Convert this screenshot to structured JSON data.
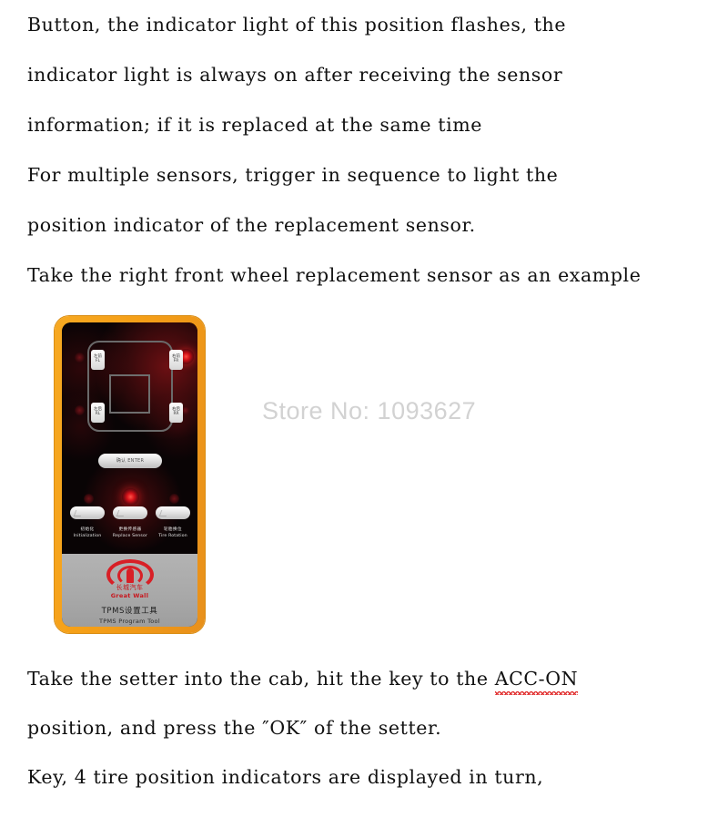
{
  "document": {
    "top_paragraph_lines": [
      "Button, the indicator light of this position flashes, the",
      "indicator light is always on after receiving the sensor",
      "information; if it is replaced at the same time",
      "For multiple sensors, trigger in sequence to light the",
      "position indicator of the replacement sensor.",
      "Take the right front wheel replacement sensor as an example"
    ],
    "bottom_paragraph": {
      "line1_before": "Take the setter into the cab, hit the key to the ",
      "line1_misspelled": "ACC-ON",
      "line2": "position, and press the ″OK″ of the setter.",
      "line3": "Key, 4 tire position indicators are displayed in turn,"
    }
  },
  "watermark": {
    "text": "Store No: 1093627",
    "color": "#d2d2d2"
  },
  "device": {
    "frame_color": "#f5a01a",
    "screen_color": "#090405",
    "panel_color": "#a8a8a8",
    "tire_labels": [
      {
        "position": "front-left",
        "cn": "左前",
        "en": "FL",
        "led": "off"
      },
      {
        "position": "front-right",
        "cn": "右前",
        "en": "FR",
        "led": "on"
      },
      {
        "position": "rear-left",
        "cn": "左后",
        "en": "RL",
        "led": "off"
      },
      {
        "position": "rear-right",
        "cn": "右后",
        "en": "RR",
        "led": "off"
      }
    ],
    "enter_button": {
      "label": "确认 ENTER"
    },
    "buttons": [
      {
        "cn": "初始化",
        "en": "Initialization"
      },
      {
        "cn": "更换传感器",
        "en": "Replace Sensor"
      },
      {
        "cn": "轮胎换位",
        "en": "Tire Rotation"
      }
    ],
    "brand": {
      "name_cn": "长城汽车",
      "name_en": "Great Wall",
      "logo_color": "#d81f26"
    },
    "product": {
      "name_cn": "TPMS设置工具",
      "name_en": "TPMS Program Tool"
    }
  }
}
